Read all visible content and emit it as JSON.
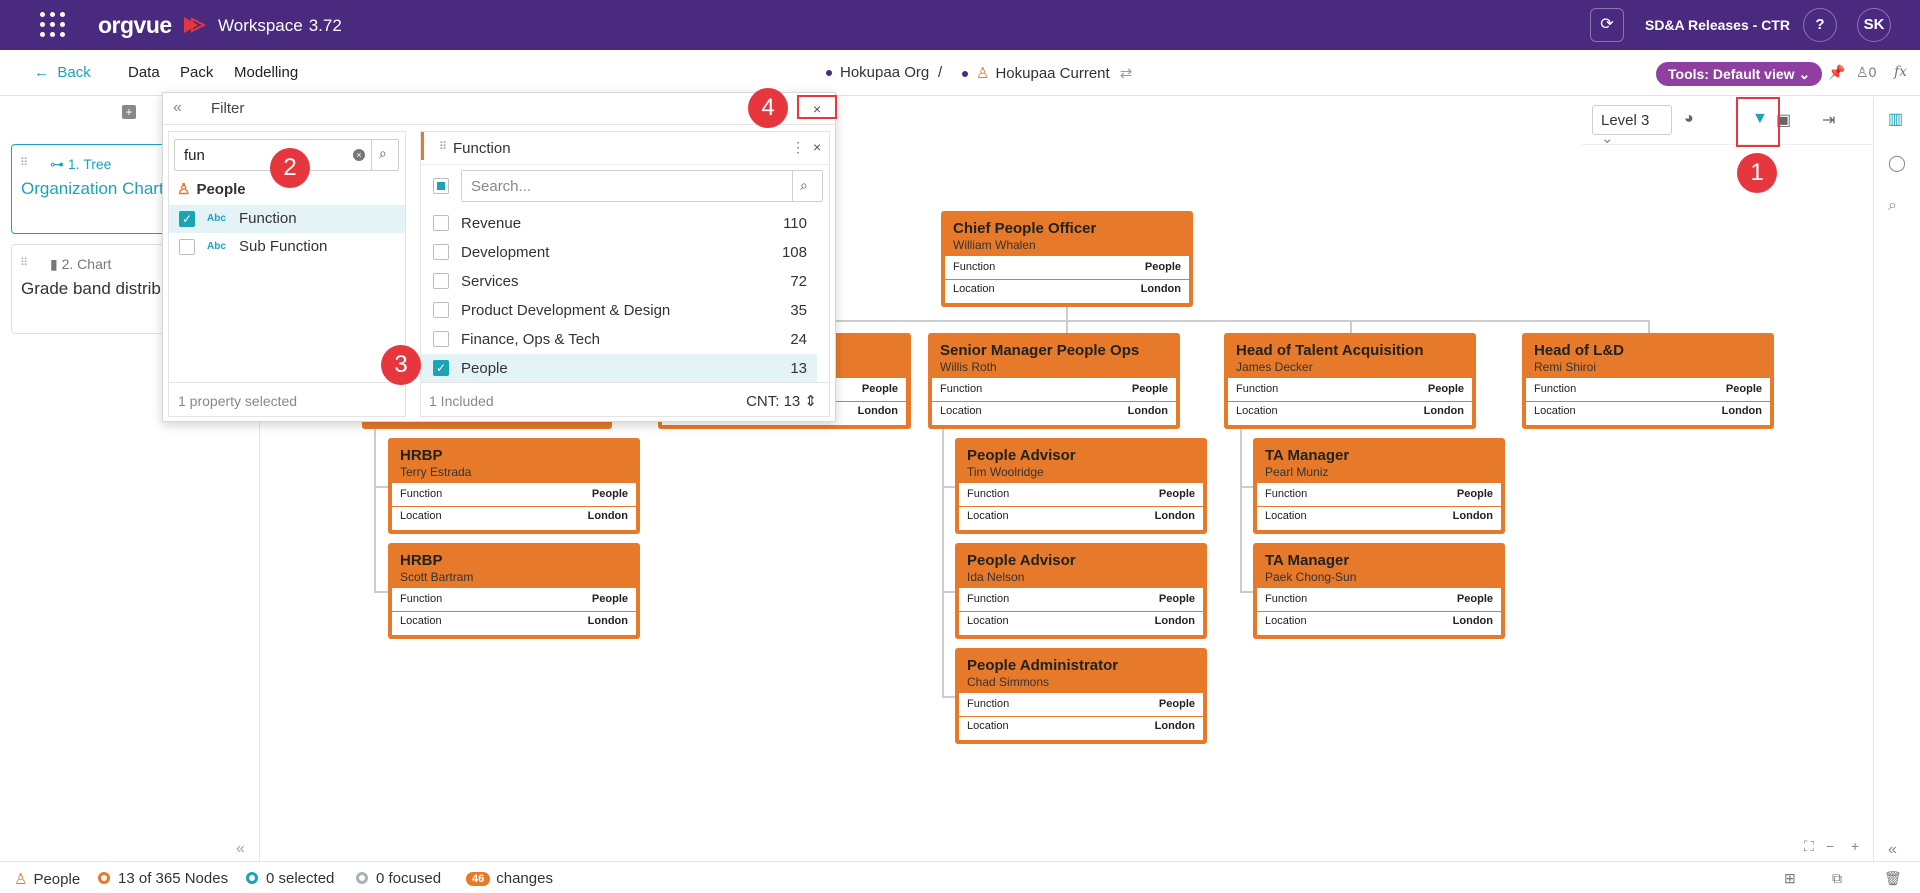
{
  "topbar": {
    "logo": "orgvue",
    "workspace": "Workspace",
    "version": "3.72",
    "release": "SD&A Releases - CTR",
    "help": "?",
    "avatar": "SK"
  },
  "subbar": {
    "back": "Back",
    "menu": [
      "Data",
      "Pack",
      "Modelling"
    ],
    "breadcrumb": [
      "Hokupaa Org",
      "/",
      "Hokupaa Current"
    ],
    "tools": "Tools: Default view",
    "pin_count": "0",
    "fx": "fx"
  },
  "leftpanel": {
    "cards": [
      {
        "kind": "1. Tree",
        "name": "Organization Chart"
      },
      {
        "kind": "2. Chart",
        "name": "Grade band distrib"
      }
    ]
  },
  "filter": {
    "title": "Filter",
    "search_value": "fun",
    "dimension": "People",
    "properties": [
      {
        "type": "Abc",
        "name": "Function",
        "checked": true
      },
      {
        "type": "Abc",
        "name": "Sub Function",
        "checked": false
      }
    ],
    "left_footer": "1 property selected",
    "panel_title": "Function",
    "value_search_placeholder": "Search...",
    "values": [
      {
        "name": "Revenue",
        "count": "110",
        "checked": false
      },
      {
        "name": "Development",
        "count": "108",
        "checked": false
      },
      {
        "name": "Services",
        "count": "72",
        "checked": false
      },
      {
        "name": "Product Development & Design",
        "count": "35",
        "checked": false
      },
      {
        "name": "Finance, Ops & Tech",
        "count": "24",
        "checked": false
      },
      {
        "name": "People",
        "count": "13",
        "checked": true
      }
    ],
    "included": "1 Included",
    "cnt": "CNT: 13"
  },
  "callouts": [
    "1",
    "2",
    "3",
    "4"
  ],
  "canvas_toolbar": {
    "level": "Level 3"
  },
  "org": {
    "field_labels": {
      "function": "Function",
      "location": "Location"
    },
    "nodes": [
      {
        "title": "Chief People Officer",
        "person": "William Whalen",
        "function": "People",
        "location": "London"
      },
      {
        "title": "Senior Manager People Ops",
        "person": "Willis Roth",
        "function": "People",
        "location": "London"
      },
      {
        "title": "Head of Talent Acquisition",
        "person": "James Decker",
        "function": "People",
        "location": "London"
      },
      {
        "title": "Head of L&D",
        "person": "Remi Shiroi",
        "function": "People",
        "location": "London"
      },
      {
        "title": "HRBP",
        "person": "Terry Estrada",
        "function": "People",
        "location": "London"
      },
      {
        "title": "HRBP",
        "person": "Scott Bartram",
        "function": "People",
        "location": "London"
      },
      {
        "title": "People Advisor",
        "person": "Tim Woolridge",
        "function": "People",
        "location": "London"
      },
      {
        "title": "People Advisor",
        "person": "Ida Nelson",
        "function": "People",
        "location": "London"
      },
      {
        "title": "People Administrator",
        "person": "Chad Simmons",
        "function": "People",
        "location": "London"
      },
      {
        "title": "TA Manager",
        "person": "Pearl Muniz",
        "function": "People",
        "location": "London"
      },
      {
        "title": "TA Manager",
        "person": "Paek Chong-Sun",
        "function": "People",
        "location": "London"
      }
    ],
    "partial_node": {
      "function": "People",
      "location": "London"
    }
  },
  "status": {
    "dimension": "People",
    "nodes": "13 of 365 Nodes",
    "selected": "0 selected",
    "focused": "0 focused",
    "changes_count": "46",
    "changes": "changes"
  },
  "colors": {
    "brand_purple": "#4a2a7e",
    "accent_teal": "#1ba3b8",
    "node_orange": "#e77a2a",
    "callout_red": "#e6373f",
    "tools_pill": "#8e3f9f"
  }
}
